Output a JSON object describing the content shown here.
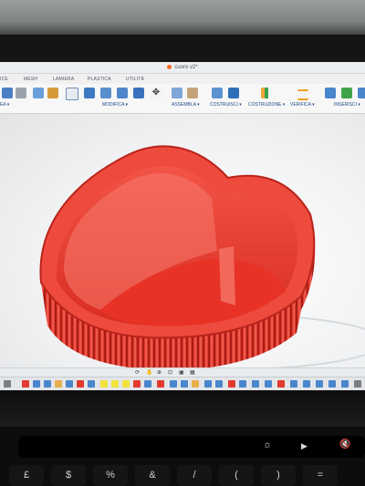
{
  "window": {
    "title": "cuore v2*"
  },
  "tabs": [
    {
      "label": "ICE"
    },
    {
      "label": "MESH"
    },
    {
      "label": "LAMIERA"
    },
    {
      "label": "PLASTICA"
    },
    {
      "label": "UTILITÀ"
    }
  ],
  "toolbar_groups": [
    {
      "label": "MODIFICA ▾"
    },
    {
      "label": "ASSEMBLA ▾"
    },
    {
      "label": "COSTRUISCI ▾"
    },
    {
      "label": "COSTRUZIONE ▾"
    },
    {
      "label": "VERIFICA ▾"
    },
    {
      "label": "INSERISCI ▾"
    }
  ],
  "toolbar_left_fragment": "EA ▾",
  "touchbar": {
    "brightness": "☼",
    "play": "▶",
    "mute": "🔇"
  },
  "keys": [
    "£",
    "$",
    "%",
    "&",
    "/",
    "(",
    ")",
    "="
  ],
  "colors": {
    "model": "#e8372c",
    "accent": "#1f4d8c",
    "app_logo": "#ff6a2a"
  }
}
